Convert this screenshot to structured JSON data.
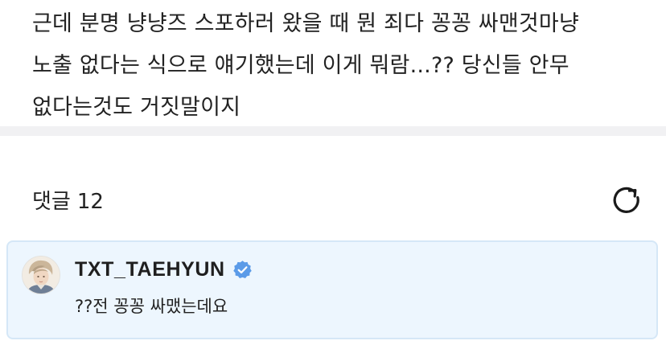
{
  "post": {
    "lines": [
      "근데 분명 냥냥즈 스포하러 왔을 때 뭔 죄다 꽁꽁 싸맨것마냥",
      "노출 없다는 식으로 얘기했는데 이게 뭐람...?? 당신들 안무",
      "없다는것도 거짓말이지"
    ]
  },
  "comments": {
    "title": "댓글",
    "count": "12",
    "refresh_icon": "refresh-icon"
  },
  "comment": {
    "author": "TXT_TAEHYUN",
    "verified_icon": "verified-badge-icon",
    "text": "??전 꽁꽁 싸맸는데요"
  },
  "colors": {
    "text": "#222222",
    "divider": "#f1f1f3",
    "card_background": "#edf6fe",
    "card_border": "#d5e7f7",
    "verified": "#5b9be8"
  }
}
